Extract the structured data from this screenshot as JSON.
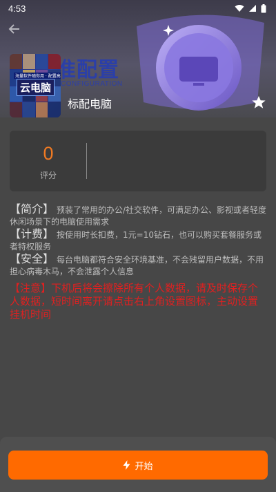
{
  "status_bar": {
    "time": "4:53"
  },
  "banner": {
    "bg_title": "准配置",
    "bg_subtitle": "CONFIGURATION",
    "cover_label": "云电脑",
    "cover_strip": "海量软件随你用 · 配置高端"
  },
  "app": {
    "name": "标配电脑"
  },
  "score": {
    "value": "0",
    "label": "评分"
  },
  "info": {
    "intro_tag": "【简介】",
    "intro_text": "预装了常用的办公/社交软件，可满足办公、影视或者轻度休闲场景下的电脑使用需求",
    "billing_tag": "【计费】",
    "billing_text": "按使用时长扣费，1元=10钻石，也可以购买套餐服务或者特权服务",
    "security_tag": "【安全】",
    "security_text": "每台电脑都符合安全环境基准，不会残留用户数据，不用担心病毒木马，不会泄露个人信息",
    "notice_tag": "【注意】",
    "notice_text": "下机后将会擦除所有个人数据，请及时保存个人数据，短时间离开请点击右上角设置图标，主动设置挂机时间"
  },
  "actions": {
    "start_label": "开始"
  },
  "colors": {
    "accent": "#ff6a00",
    "score": "#f07a23",
    "notice": "#e02020",
    "banner_title": "#2b3fa8"
  },
  "icons": [
    "back-arrow-icon",
    "star-icon",
    "lightning-icon",
    "wifi-icon",
    "signal-icon",
    "battery-icon"
  ]
}
